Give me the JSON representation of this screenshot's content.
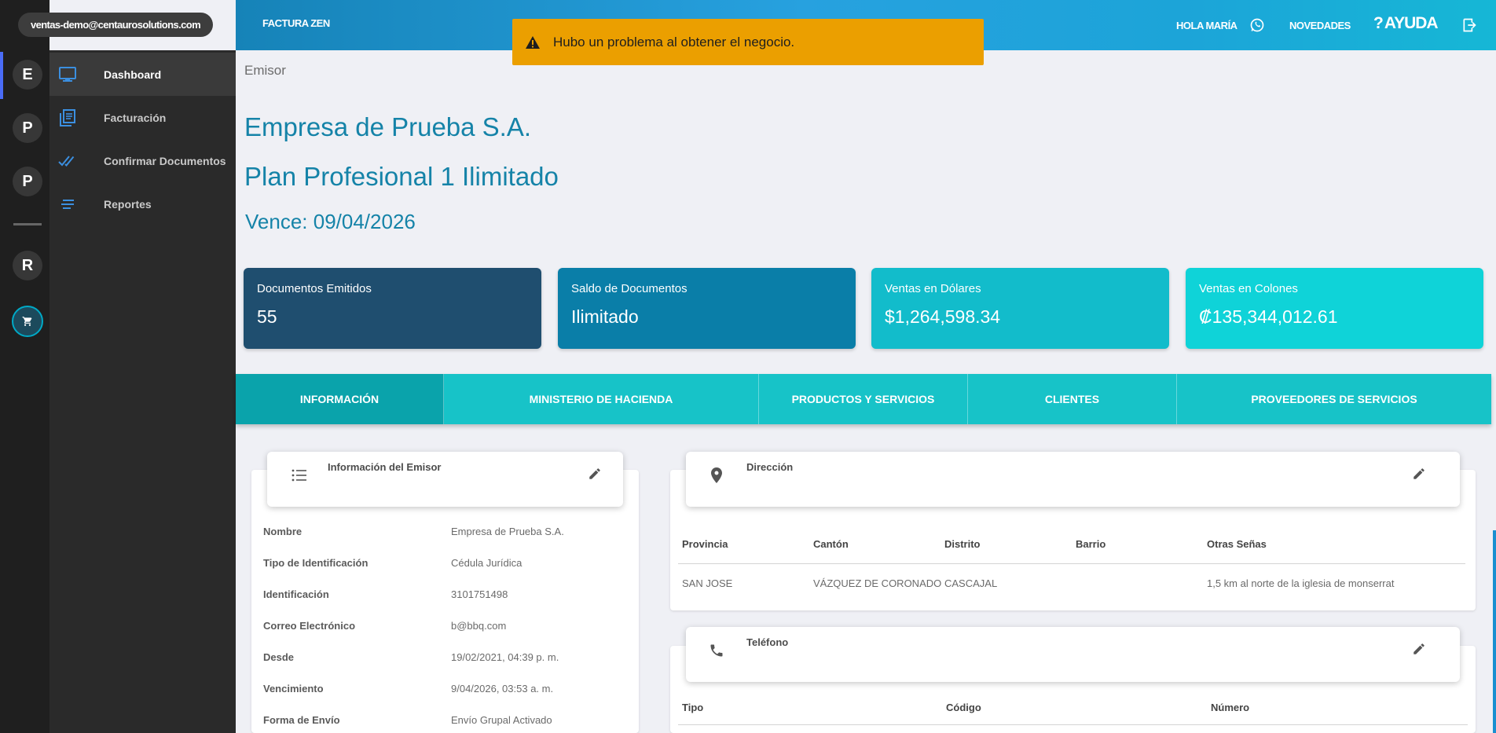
{
  "user": {
    "email": "ventas-demo@centaurosolutions.com"
  },
  "rail": {
    "items": [
      {
        "letter": "E"
      },
      {
        "letter": "P"
      },
      {
        "letter": "P"
      },
      {
        "letter": "R"
      }
    ],
    "cart_icon": "cart-icon",
    "accent": "#00a9c6"
  },
  "sidebar": {
    "items": [
      {
        "label": "Dashboard",
        "icon": "monitor-icon",
        "active": true
      },
      {
        "label": "Facturación",
        "icon": "document-icon",
        "active": false
      },
      {
        "label": "Confirmar Documentos",
        "icon": "double-check-icon",
        "active": false
      },
      {
        "label": "Reportes",
        "icon": "list-lines-icon",
        "active": false
      }
    ]
  },
  "topbar": {
    "brand": "FACTURA ZEN",
    "greeting": "HOLA MARÍA",
    "whatsapp_icon": "whatsapp-icon",
    "news": "NOVEDADES",
    "help": "AYUDA",
    "logout_icon": "logout-icon"
  },
  "alert": {
    "icon": "warning-icon",
    "message": "Hubo un problema al obtener el negocio.",
    "color": "#eb9f00"
  },
  "header": {
    "breadcrumb": "Emisor",
    "company": "Empresa de Prueba S.A.",
    "plan": "Plan Profesional 1 Ilimitado",
    "expiry": "Vence: 09/04/2026"
  },
  "stats": [
    {
      "label": "Documentos Emitidos",
      "value": "55",
      "color": "#1f4e6f"
    },
    {
      "label": "Saldo de Documentos",
      "value": "Ilimitado",
      "color": "#0a7ea8"
    },
    {
      "label": "Ventas en Dólares",
      "value": "$1,264,598.34",
      "color": "#12bccb"
    },
    {
      "label": "Ventas en Colones",
      "value": "₡135,344,012.61",
      "color": "#0fd3d8"
    }
  ],
  "tabs": [
    {
      "label": "INFORMACIÓN",
      "active": true
    },
    {
      "label": "MINISTERIO DE HACIENDA",
      "active": false
    },
    {
      "label": "PRODUCTOS Y SERVICIOS",
      "active": false
    },
    {
      "label": "CLIENTES",
      "active": false
    },
    {
      "label": "PROVEEDORES DE SERVICIOS",
      "active": false
    }
  ],
  "emisor_info": {
    "title": "Información del Emisor",
    "icon": "list-icon",
    "rows": [
      {
        "key": "Nombre",
        "value": "Empresa de Prueba S.A."
      },
      {
        "key": "Tipo de Identificación",
        "value": "Cédula Jurídica"
      },
      {
        "key": "Identificación",
        "value": "3101751498"
      },
      {
        "key": "Correo Electrónico",
        "value": "b@bbq.com"
      },
      {
        "key": "Desde",
        "value": "19/02/2021, 04:39 p. m."
      },
      {
        "key": "Vencimiento",
        "value": "9/04/2026, 03:53 a. m."
      },
      {
        "key": "Forma de Envío",
        "value": "Envío Grupal Activado"
      }
    ]
  },
  "direccion": {
    "title": "Dirección",
    "icon": "location-pin-icon",
    "columns": [
      "Provincia",
      "Cantón",
      "Distrito",
      "Barrio",
      "Otras Señas"
    ],
    "row": [
      "SAN JOSE",
      "VÁZQUEZ DE CORONADO",
      "CASCAJAL",
      "",
      "1,5 km al norte de la iglesia de monserrat"
    ]
  },
  "telefono": {
    "title": "Teléfono",
    "icon": "phone-icon",
    "columns": [
      "Tipo",
      "Código",
      "Número"
    ]
  }
}
